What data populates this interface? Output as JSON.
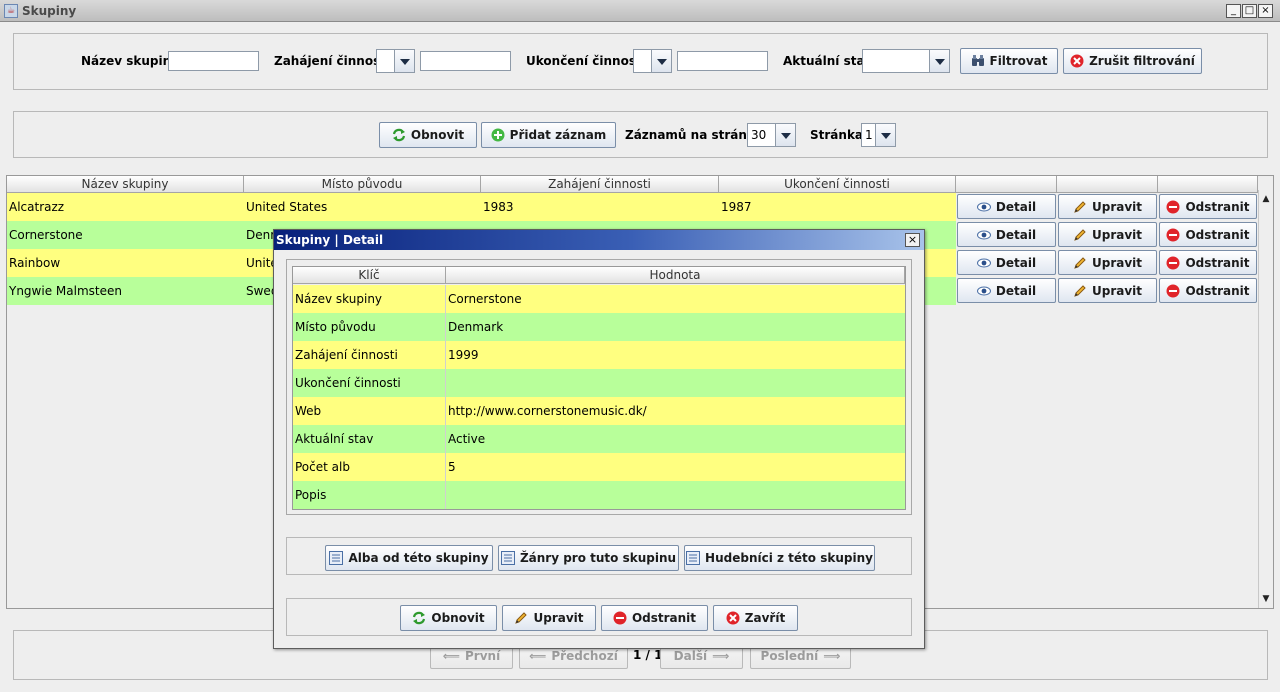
{
  "window": {
    "title": "Skupiny",
    "minimize": "_",
    "maximize": "□",
    "close": "×"
  },
  "filter": {
    "name_label": "Název skupiny",
    "start_label": "Zahájení činnosti",
    "end_label": "Ukončení činnosti",
    "state_label": "Aktuální stav",
    "filter_button": "Filtrovat",
    "cancel_button": "Zrušit filtrování"
  },
  "toolbar": {
    "refresh": "Obnovit",
    "add": "Přidat záznam",
    "per_page_label": "Záznamů na stránku",
    "per_page_value": "30",
    "page_label": "Stránka",
    "page_value": "1"
  },
  "table": {
    "columns": [
      "Název skupiny",
      "Místo původu",
      "Zahájení činnosti",
      "Ukončení činnosti"
    ],
    "rows": [
      {
        "name": "Alcatrazz",
        "origin": "United States",
        "start": "1983",
        "end": "1987",
        "color": "#ffff80"
      },
      {
        "name": "Cornerstone",
        "origin": "Denmark",
        "start": "1999",
        "end": "",
        "color": "#b8ff9a"
      },
      {
        "name": "Rainbow",
        "origin": "United Kingdom",
        "start": "",
        "end": "",
        "color": "#ffff80"
      },
      {
        "name": "Yngwie Malmsteen",
        "origin": "Sweden",
        "start": "",
        "end": "",
        "color": "#b8ff9a"
      }
    ],
    "row_actions": {
      "detail": "Detail",
      "edit": "Upravit",
      "delete": "Odstranit"
    }
  },
  "pagination": {
    "first": "První",
    "prev": "Předchozí",
    "status": "1 / 1",
    "next": "Další",
    "last": "Poslední"
  },
  "dialog": {
    "title": "Skupiny | Detail",
    "close": "×",
    "key_header": "Klíč",
    "value_header": "Hodnota",
    "rows": [
      {
        "key": "Název skupiny",
        "value": "Cornerstone"
      },
      {
        "key": "Místo původu",
        "value": "Denmark"
      },
      {
        "key": "Zahájení činnosti",
        "value": "1999"
      },
      {
        "key": "Ukončení činnosti",
        "value": ""
      },
      {
        "key": "Web",
        "value": "http://www.cornerstonemusic.dk/"
      },
      {
        "key": "Aktuální stav",
        "value": "Active"
      },
      {
        "key": "Počet alb",
        "value": "5"
      },
      {
        "key": "Popis",
        "value": ""
      }
    ],
    "albums_button": "Alba od této skupiny",
    "genres_button": "Žánry pro tuto skupinu",
    "musicians_button": "Hudebníci z této skupiny",
    "refresh_button": "Obnovit",
    "edit_button": "Upravit",
    "delete_button": "Odstranit",
    "close_button": "Zavřít"
  },
  "colors": {
    "row_yellow": "#ffff80",
    "row_green": "#b8ff9a",
    "dialog_title": "#07207a"
  },
  "icons": [
    "refresh-icon",
    "add-icon",
    "binoculars-icon",
    "cancel-icon",
    "eye-icon",
    "pencil-icon",
    "delete-icon",
    "close-icon",
    "list-icon"
  ]
}
